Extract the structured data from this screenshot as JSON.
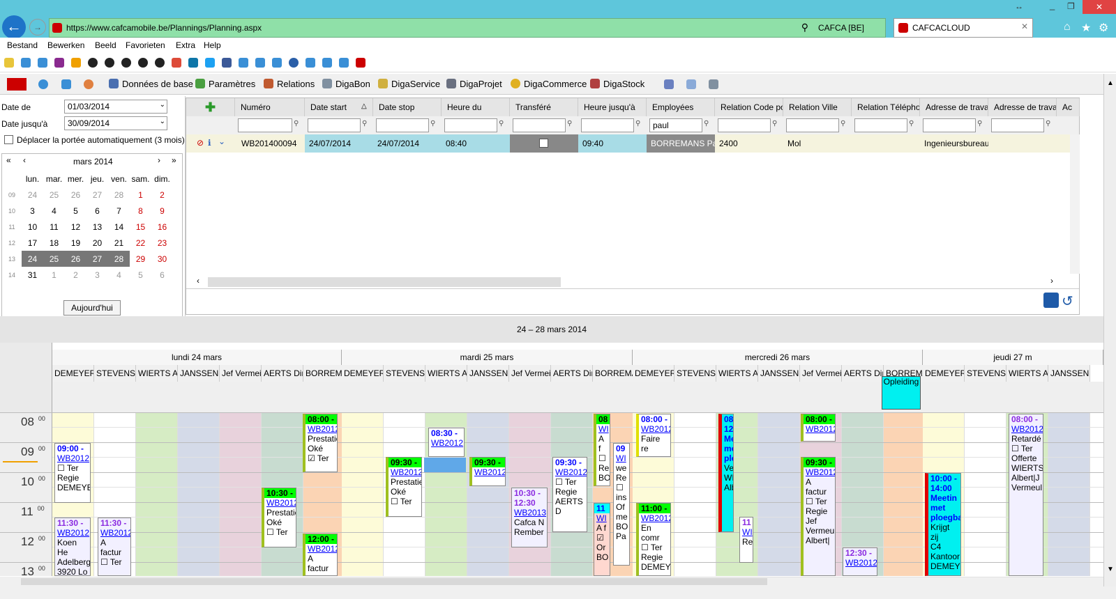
{
  "browser": {
    "url": "https://www.cafcamobile.be/Plannings/Planning.aspx",
    "security": "CAFCA [BE]",
    "tab_title": "CAFCACLOUD",
    "menu": [
      "Bestand",
      "Bewerken",
      "Beeld",
      "Favorieten",
      "Extra",
      "Help"
    ]
  },
  "app_toolbar": [
    "Données de base",
    "Paramètres",
    "Relations",
    "DigaBon",
    "DigaService",
    "DigaProjet",
    "DigaCommerce",
    "DigaStock"
  ],
  "filters": {
    "date_de_label": "Date de",
    "date_de": "01/03/2014",
    "date_jusqua_label": "Date jusqu'à",
    "date_jusqua": "30/09/2014",
    "move_label": "Déplacer la portée automatiquement (3 mois)"
  },
  "calendar": {
    "month": "mars 2014",
    "weekdays": [
      "lun.",
      "mar.",
      "mer.",
      "jeu.",
      "ven.",
      "sam.",
      "dim."
    ],
    "weeks": [
      {
        "wk": "09",
        "days": [
          "24",
          "25",
          "26",
          "27",
          "28",
          "1",
          "2"
        ]
      },
      {
        "wk": "10",
        "days": [
          "3",
          "4",
          "5",
          "6",
          "7",
          "8",
          "9"
        ]
      },
      {
        "wk": "11",
        "days": [
          "10",
          "11",
          "12",
          "13",
          "14",
          "15",
          "16"
        ]
      },
      {
        "wk": "12",
        "days": [
          "17",
          "18",
          "19",
          "20",
          "21",
          "22",
          "23"
        ]
      },
      {
        "wk": "13",
        "days": [
          "24",
          "25",
          "26",
          "27",
          "28",
          "29",
          "30"
        ]
      },
      {
        "wk": "14",
        "days": [
          "31",
          "1",
          "2",
          "3",
          "4",
          "5",
          "6"
        ]
      }
    ],
    "today_button": "Aujourd'hui"
  },
  "grid": {
    "columns": [
      "Numéro",
      "Date start",
      "Date stop",
      "Heure du",
      "Transféré",
      "Heure jusqu'à",
      "Employées",
      "Relation Code po:",
      "Relation Ville",
      "Relation Téléphor",
      "Adresse de travai",
      "Adresse de travai",
      "Ac"
    ],
    "employee_filter": "paul",
    "row": {
      "numero": "WB201400094",
      "date_start": "24/07/2014",
      "date_stop": "24/07/2014",
      "heure_du": "08:40",
      "heure_jusqua": "09:40",
      "employee": "BORREMANS Pau",
      "code": "2400",
      "ville": "Mol",
      "adresse": "Ingenieursbureau"
    }
  },
  "schedule": {
    "range": "24 – 28 mars 2014",
    "days": [
      "lundi 24 mars",
      "mardi 25 mars",
      "mercredi 26 mars",
      "jeudi 27 m"
    ],
    "resources": [
      "DEMEYER",
      "STEVENS (",
      "WIERTS A",
      "JANSSEN I",
      "Jef Vermei",
      "AERTS Dir",
      "BORREMAI"
    ],
    "hours": [
      "08",
      "09",
      "10",
      "11",
      "12",
      "13"
    ],
    "minutes": "00",
    "allday_event": "Opleiding"
  },
  "colors": {
    "browser_bar": "#5ec6db",
    "address_bar": "#8fe0a8",
    "selected_row": "#a8dce6",
    "header": "#e5e5e5"
  }
}
